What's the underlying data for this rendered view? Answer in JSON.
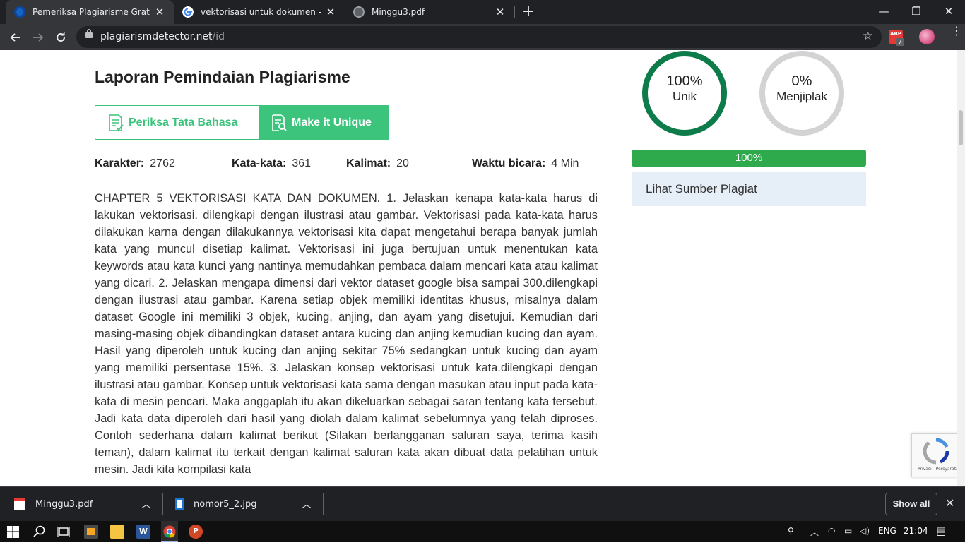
{
  "browser": {
    "tabs": [
      {
        "title": "Pemeriksa Plagiarisme Gratis | Ak",
        "active": true
      },
      {
        "title": "vektorisasi untuk dokumen - Goo",
        "active": false
      },
      {
        "title": "Minggu3.pdf",
        "active": false
      }
    ],
    "new_tab_glyph": "+",
    "window_controls": {
      "minimize": "—",
      "maximize": "❐",
      "close": "✕"
    },
    "url_host": "plagiarismdetector.net",
    "url_path": "/id",
    "extension_badge": "7",
    "extension_label": "ABP"
  },
  "report": {
    "title": "Laporan Pemindaian Plagiarisme",
    "grammar_button": "Periksa Tata Bahasa",
    "unique_button": "Make it Unique",
    "stats": {
      "characters_label": "Karakter:",
      "characters_value": "2762",
      "words_label": "Kata-kata:",
      "words_value": "361",
      "sentences_label": "Kalimat:",
      "sentences_value": "20",
      "speak_label": "Waktu bicara:",
      "speak_value": "4 Min"
    },
    "text": "CHAPTER 5 VEKTORISASI KATA DAN DOKUMEN. 1. Jelaskan kenapa kata-kata harus di lakukan vektorisasi. dilengkapi dengan ilustrasi atau gambar. Vektorisasi pada kata-kata harus dilakukan karna dengan dilakukannya vektorisasi kita dapat mengetahui berapa banyak jumlah kata yang muncul disetiap kalimat. Vektorisasi ini juga bertujuan untuk menentukan kata keywords atau kata kunci yang nantinya memudahkan pembaca dalam mencari kata atau kalimat yang dicari. 2. Jelaskan mengapa dimensi dari vektor dataset google bisa sampai 300.dilengkapi dengan ilustrasi atau gambar. Karena setiap objek memiliki identitas khusus, misalnya dalam dataset Google ini memiliki 3 objek, kucing, anjing, dan ayam yang disetujui. Kemudian dari masing-masing objek dibandingkan dataset antara kucing dan anjing kemudian kucing dan ayam. Hasil yang diperoleh untuk kucing dan anjing sekitar 75% sedangkan untuk kucing dan ayam yang memiliki persentase 15%. 3. Jelaskan konsep vektorisasi untuk kata.dilengkapi dengan ilustrasi atau gambar. Konsep untuk vektorisasi kata sama dengan masukan atau input pada kata-kata di mesin pencari. Maka anggaplah itu akan dikeluarkan sebagai saran tentang kata tersebut. Jadi kata data diperoleh dari hasil yang diolah dalam kalimat sebelumnya yang telah diproses. Contoh sederhana dalam kalimat berikut (Silakan berlangganan saluran saya, terima kasih teman), dalam kalimat itu terkait dengan kalimat saluran kata akan dibuat data pelatihan untuk mesin. Jadi kita kompilasi kata"
  },
  "results": {
    "unique_pct": "100%",
    "unique_label": "Unik",
    "plagiarized_pct": "0%",
    "plagiarized_label": "Menjiplak",
    "progress_value": 1.0,
    "progress_text": "100%",
    "sources_label": "Lihat Sumber Plagiat",
    "recaptcha_text": "Privasi - Persyaratan"
  },
  "downloads": {
    "items": [
      {
        "name": "Minggu3.pdf"
      },
      {
        "name": "nomor5_2.jpg"
      }
    ],
    "show_all": "Show all",
    "close_glyph": "✕"
  },
  "taskbar": {
    "language": "ENG",
    "time": "21:04"
  },
  "colors": {
    "accent_green": "#3cc47c",
    "unique_ring": "#0e7c4a",
    "plag_ring": "#d3d3d3",
    "progress": "#2eaa4c",
    "sources_bg": "#e6eef7"
  }
}
